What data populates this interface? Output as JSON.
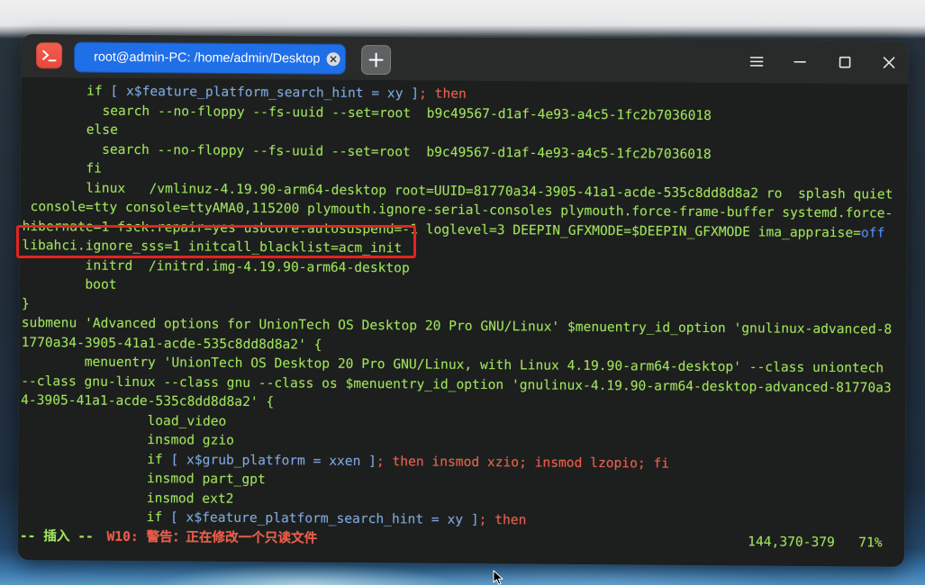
{
  "window": {
    "tab_title": "root@admin-PC: /home/admin/Desktop"
  },
  "terminal": {
    "lines": [
      {
        "segments": [
          "        if ",
          "[ x$feature_platform_search_hint = xy ]",
          "; then"
        ]
      },
      {
        "segments": [
          "          search --no-floppy --fs-uuid --set=root  b9c49567-d1af-4e93-a4c5-1fc2b7036018"
        ]
      },
      {
        "segments": [
          "        else"
        ]
      },
      {
        "segments": [
          "          search --no-floppy --fs-uuid --set=root  b9c49567-d1af-4e93-a4c5-1fc2b7036018"
        ]
      },
      {
        "segments": [
          "        fi"
        ]
      },
      {
        "segments": [
          "        linux   /vmlinuz-4.19.90-arm64-desktop root=UUID=81770a34-3905-41a1-acde-535c8dd8d8a2 ro  splash quiet"
        ]
      },
      {
        "segments": [
          " console=tty console=ttyAMA0,115200 plymouth.ignore-serial-consoles plymouth.force-frame-buffer systemd.force-"
        ]
      },
      {
        "segments": [
          "hibernate=1 fsck.repair=yes usbcore.autosuspend=-1 loglevel=3 DEEPIN_GFXMODE=$DEEPIN_GFXMODE ima_appraise=",
          "off"
        ]
      },
      {
        "segments": [
          "libahci.ignore_sss=1 initcall_blacklist=acm_init"
        ]
      },
      {
        "segments": [
          "        initrd  /initrd.img-4.19.90-arm64-desktop"
        ]
      },
      {
        "segments": [
          "        boot"
        ]
      },
      {
        "segments": [
          "}"
        ]
      },
      {
        "segments": [
          "submenu 'Advanced options for UnionTech OS Desktop 20 Pro GNU/Linux' $menuentry_id_option 'gnulinux-advanced-8"
        ]
      },
      {
        "segments": [
          "1770a34-3905-41a1-acde-535c8dd8d8a2' {"
        ]
      },
      {
        "segments": [
          "        menuentry 'UnionTech OS Desktop 20 Pro GNU/Linux, with Linux 4.19.90-arm64-desktop' --class uniontech"
        ]
      },
      {
        "segments": [
          "--class gnu-linux --class gnu --class os $menuentry_id_option 'gnulinux-4.19.90-arm64-desktop-advanced-81770a3"
        ]
      },
      {
        "segments": [
          "4-3905-41a1-acde-535c8dd8d8a2' {"
        ]
      },
      {
        "segments": [
          "                load_video"
        ]
      },
      {
        "segments": [
          "                insmod gzio"
        ]
      },
      {
        "segments": [
          "                if ",
          "[ x$grub_platform = xxen ]",
          "; then insmod xzio; insmod lzopio; fi"
        ]
      },
      {
        "segments": [
          "                insmod part_gpt"
        ]
      },
      {
        "segments": [
          "                insmod ext2"
        ]
      },
      {
        "segments": [
          "                if ",
          "[ x$feature_platform_search_hint = xy ]",
          "; then"
        ]
      }
    ],
    "status": {
      "mode": "-- 插入 --",
      "warning": "W10: 警告：正在修改一个只读文件",
      "position": "144,370-379",
      "percent": "71%"
    }
  },
  "icons": {
    "app": "terminal-icon",
    "tab_close": "close-icon",
    "new_tab": "plus-icon",
    "menu": "menu-icon",
    "minimize": "minimize-icon",
    "maximize": "maximize-icon",
    "window_close": "close-icon",
    "pointer": "mouse-cursor-icon"
  },
  "colors": {
    "text_green": "#9fe35c",
    "syntax_blue": "#7ba4ea",
    "value_blue": "#4d86ff",
    "keyword_red": "#f2584b",
    "highlight_red": "#e3241f",
    "tab_blue": "#1f6fe8",
    "app_icon_red": "#e8473c",
    "terminal_bg": "#1d1e1e",
    "titlebar_bg": "#292a2a"
  }
}
